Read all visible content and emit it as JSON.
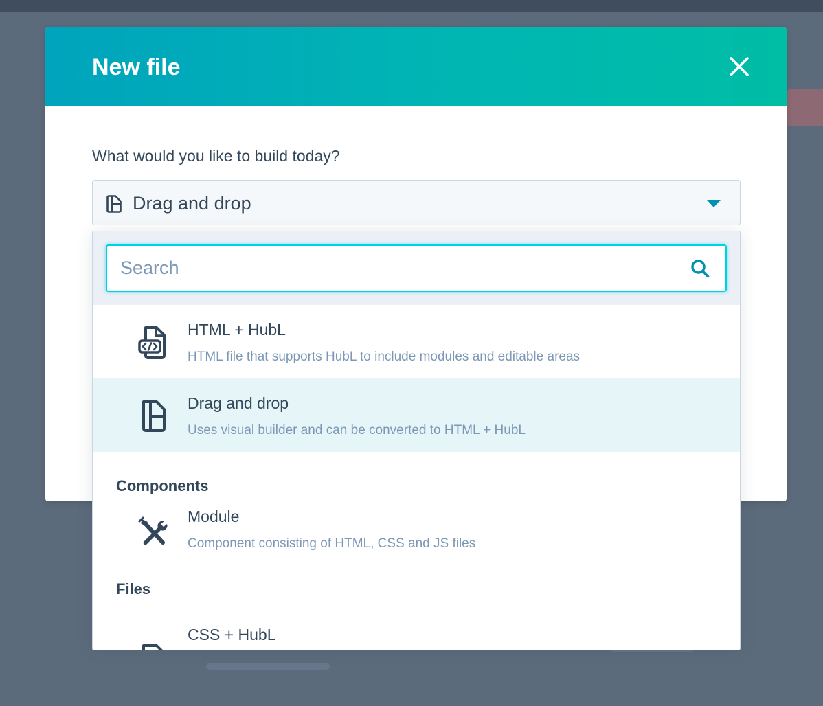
{
  "modal": {
    "title": "New file",
    "close_label": "Close"
  },
  "form": {
    "question": "What would you like to build today?",
    "selected_value": "Drag and drop",
    "selected_icon": "page-layout-icon"
  },
  "dropdown": {
    "search_placeholder": "Search",
    "options": [
      {
        "title": "HTML + HubL",
        "description": "HTML file that supports HubL to include modules and editable areas",
        "icon": "code-file-icon"
      },
      {
        "title": "Drag and drop",
        "description": "Uses visual builder and can be converted to HTML + HubL",
        "icon": "page-layout-icon",
        "active": true
      }
    ],
    "groups": [
      {
        "heading": "Components",
        "options": [
          {
            "title": "Module",
            "description": "Component consisting of HTML, CSS and JS files",
            "icon": "tools-icon"
          }
        ]
      },
      {
        "heading": "Files",
        "options": [
          {
            "title": "CSS + HubL",
            "description": "",
            "icon": "file-icon"
          }
        ]
      }
    ]
  },
  "colors": {
    "header_gradient_start": "#00a4bd",
    "header_gradient_end": "#00bda5",
    "text_primary": "#33475b",
    "text_secondary": "#7c98b6",
    "accent": "#0091ae",
    "focus_ring": "#00d0e4",
    "active_option_bg": "#e5f5f8"
  }
}
